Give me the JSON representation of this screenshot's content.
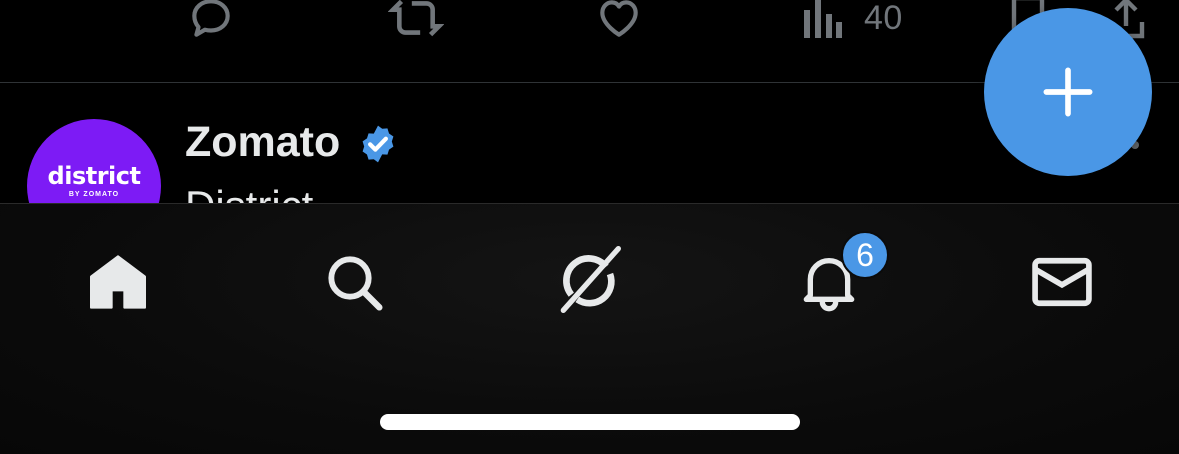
{
  "tweet_actions": {
    "reply_icon": "speech-bubble",
    "retweet_icon": "retweet-arrows",
    "like_icon": "heart",
    "views_icon": "bar-chart",
    "views_count": "40",
    "bookmark_icon": "bookmark",
    "share_icon": "share-upload"
  },
  "next_tweet": {
    "avatar_brand": "district",
    "avatar_subtext": "BY ZOMATO",
    "author_name": "Zomato",
    "verified": true,
    "text": "District"
  },
  "nav": {
    "items": [
      {
        "name": "home",
        "icon": "house",
        "active": true
      },
      {
        "name": "search",
        "icon": "magnifier"
      },
      {
        "name": "grok",
        "icon": "grok-slash-circle"
      },
      {
        "name": "notifications",
        "icon": "bell"
      },
      {
        "name": "messages",
        "icon": "envelope"
      }
    ],
    "notification_count": "6"
  },
  "fab": {
    "icon": "plus"
  },
  "colors": {
    "accent": "#4a97e6",
    "background": "#000000",
    "avatar_purple": "#7d1bf5",
    "muted": "#71767b"
  }
}
